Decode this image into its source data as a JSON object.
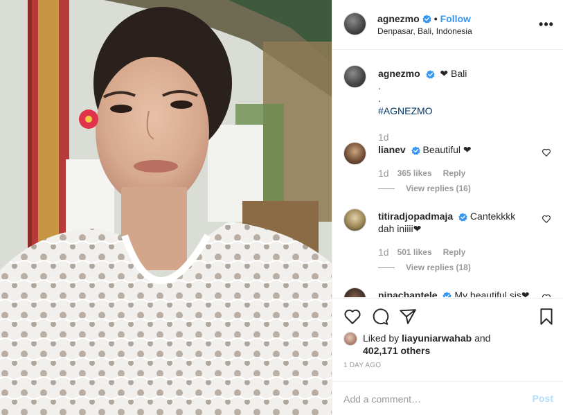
{
  "post": {
    "author": "agnezmo",
    "follow_label": "Follow",
    "location": "Denpasar, Bali, Indonesia",
    "more_icon": "more-options-icon"
  },
  "caption": {
    "author": "agnezmo",
    "text": "Bali",
    "line2": ".",
    "line3": ".",
    "hashtag": "#AGNEZMO",
    "time": "1d"
  },
  "comments": [
    {
      "author": "lianev",
      "text": "Beautiful ❤",
      "time": "1d",
      "likes": "365 likes",
      "reply_label": "Reply",
      "view_replies": "View replies (16)"
    },
    {
      "author": "titiradjopadmaja",
      "text": "Cantekkkk dah iniiii❤",
      "time": "1d",
      "likes": "501 likes",
      "reply_label": "Reply",
      "view_replies": "View replies (18)"
    },
    {
      "author": "ninachantele",
      "text": "My beautiful sis❤"
    }
  ],
  "liked_by": {
    "prefix": "Liked by",
    "user": "liayuniarwahab",
    "connector": "and",
    "others": "402,171 others"
  },
  "post_time": "1 DAY AGO",
  "add_comment": {
    "placeholder": "Add a comment…",
    "post_label": "Post"
  },
  "colors": {
    "link_blue": "#3897f0",
    "hashtag_blue": "#003569",
    "muted_gray": "#999999",
    "post_disabled": "#b2dffc",
    "verified_blue": "#3897f0"
  }
}
